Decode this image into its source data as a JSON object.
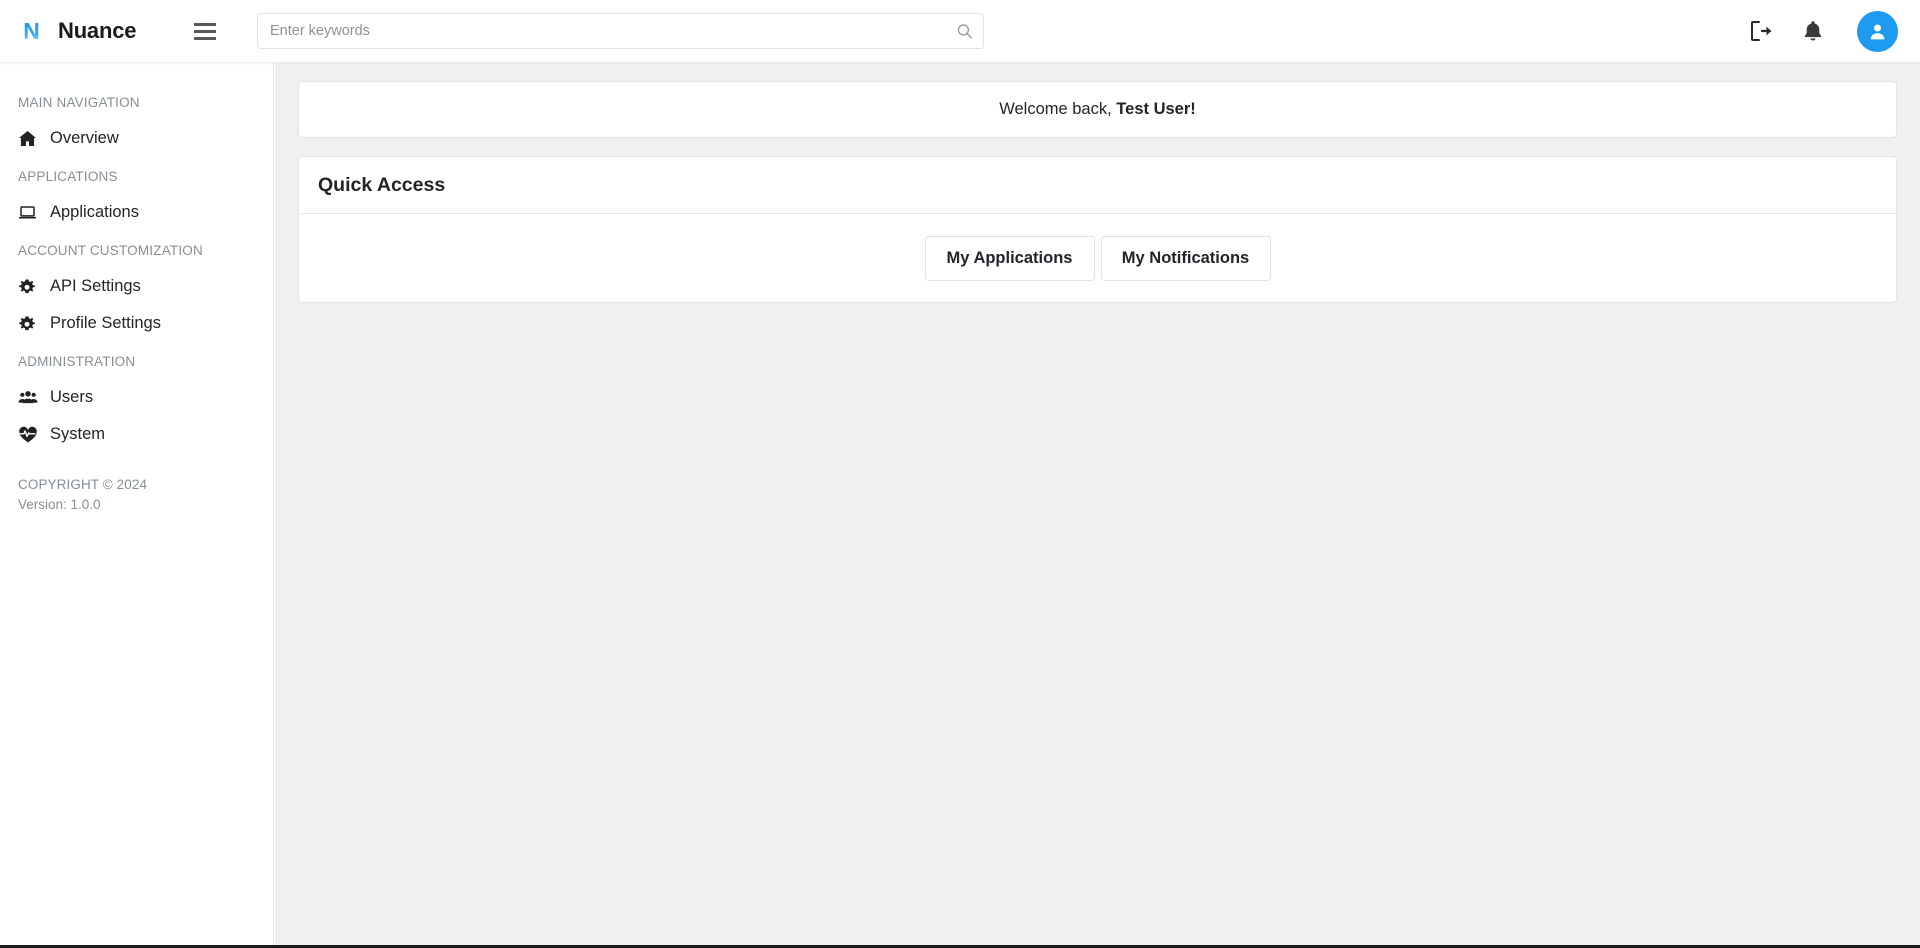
{
  "header": {
    "brand_name": "Nuance",
    "logo_letter": "N",
    "menu_icon": "hamburger-icon",
    "search": {
      "placeholder": "Enter keywords",
      "value": "",
      "icon": "search-icon"
    },
    "actions": [
      {
        "name": "logout-button",
        "icon": "logout-icon"
      },
      {
        "name": "notifications-button",
        "icon": "bell-icon"
      },
      {
        "name": "user-avatar-button",
        "icon": "user-icon"
      }
    ],
    "accent_color": "#1e9bf0"
  },
  "sidebar": {
    "groups": [
      {
        "heading": "MAIN NAVIGATION",
        "items": [
          {
            "label": "Overview",
            "icon": "home-icon",
            "name": "sidebar-item-overview"
          }
        ]
      },
      {
        "heading": "APPLICATIONS",
        "items": [
          {
            "label": "Applications",
            "icon": "laptop-icon",
            "name": "sidebar-item-applications"
          }
        ]
      },
      {
        "heading": "ACCOUNT CUSTOMIZATION",
        "items": [
          {
            "label": "API Settings",
            "icon": "gear-icon",
            "name": "sidebar-item-api-settings"
          },
          {
            "label": "Profile Settings",
            "icon": "gear-icon",
            "name": "sidebar-item-profile-settings"
          }
        ]
      },
      {
        "heading": "ADMINISTRATION",
        "items": [
          {
            "label": "Users",
            "icon": "users-icon",
            "name": "sidebar-item-users"
          },
          {
            "label": "System",
            "icon": "heartbeat-icon",
            "name": "sidebar-item-system"
          }
        ]
      }
    ],
    "footer": {
      "copyright": "COPYRIGHT © 2024",
      "version": "Version: 1.0.0"
    }
  },
  "main": {
    "welcome": {
      "greeting": "Welcome back,",
      "user_name": "Test User!"
    },
    "quick_access": {
      "title": "Quick Access",
      "buttons": [
        {
          "label": "My Applications",
          "name": "my-applications-button"
        },
        {
          "label": "My Notifications",
          "name": "my-notifications-button"
        }
      ]
    }
  }
}
